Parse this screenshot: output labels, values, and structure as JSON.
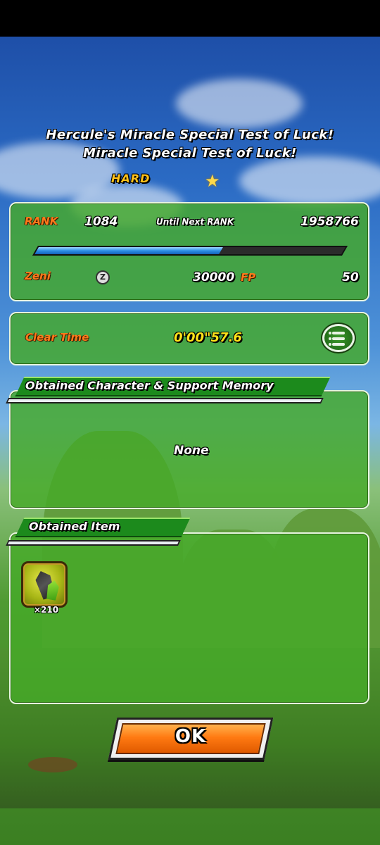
{
  "header": {
    "quest_title": "Hercule's Miracle Special Test of Luck!",
    "stage_title": "Miracle Special Test of Luck!",
    "difficulty": "HARD"
  },
  "rank_panel": {
    "rank_label": "RANK",
    "rank_value": "1084",
    "until_next_label": "Until Next RANK",
    "until_next_value": "1958766",
    "exp_progress": 0.6,
    "zeni_label": "Zeni",
    "zeni_icon_glyph": "Z",
    "zeni_value": "30000",
    "fp_label": "FP",
    "fp_value": "50"
  },
  "clear_panel": {
    "label": "Clear Time",
    "value": "0'00\"57.6"
  },
  "characters_section": {
    "title": "Obtained Character & Support Memory",
    "empty_text": "None"
  },
  "items_section": {
    "title": "Obtained Item",
    "items": [
      {
        "icon": "awakening-medal-icon",
        "quantity": "×210"
      }
    ]
  },
  "ok_button": {
    "label": "OK"
  },
  "colors": {
    "panel_green": "#46aa28",
    "label_orange": "#ff7a1a",
    "time_yellow": "#ffe31a",
    "exp_bar_blue": "#2d8fe6",
    "button_orange": "#ff7a12"
  }
}
